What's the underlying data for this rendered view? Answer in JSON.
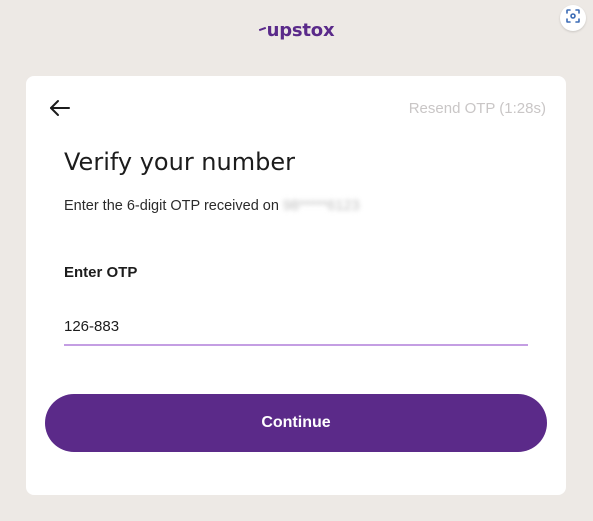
{
  "header": {
    "logo_text": "upstox",
    "scan_icon": "scan-icon"
  },
  "card": {
    "back_icon": "arrow-left-icon",
    "resend_text": "Resend OTP (1:28s)",
    "title": "Verify your number",
    "subtitle": "Enter the 6-digit OTP received on",
    "masked_number": "98*****6123",
    "otp_label": "Enter OTP",
    "otp_value": "126-883",
    "continue_label": "Continue"
  },
  "colors": {
    "background": "#ede9e5",
    "brand": "#5b2a89",
    "input_underline": "#c49ee3",
    "resend_disabled": "#c9c6c6"
  }
}
